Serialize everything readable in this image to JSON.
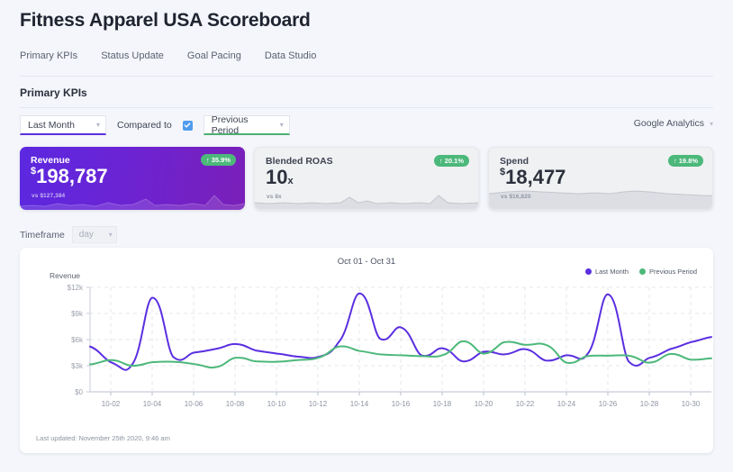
{
  "header": {
    "title": "Fitness Apparel USA Scoreboard",
    "tabs": [
      {
        "label": "Primary KPIs",
        "active": true
      },
      {
        "label": "Status Update",
        "active": false
      },
      {
        "label": "Goal Pacing",
        "active": false
      },
      {
        "label": "Data Studio",
        "active": false
      }
    ]
  },
  "section": {
    "title": "Primary KPIs"
  },
  "filters": {
    "date_range": "Last Month",
    "compare_label": "Compared to",
    "compare_checked": true,
    "compare_range": "Previous Period",
    "data_source": "Google Analytics",
    "chevron": "chevron-down-icon"
  },
  "cards": [
    {
      "label": "Revenue",
      "symbol": "$",
      "value": "198,787",
      "suffix": "",
      "prev": "vs $127,384",
      "delta": "35.9%",
      "delta_arrow": "↑",
      "delta_color": "#4cb87a",
      "style": "primary"
    },
    {
      "label": "Blended ROAS",
      "symbol": "",
      "value": "10",
      "suffix": "x",
      "prev": "vs 8x",
      "delta": "20.1%",
      "delta_arrow": "↑",
      "delta_color": "#4cb87a",
      "style": "muted"
    },
    {
      "label": "Spend",
      "symbol": "$",
      "value": "18,477",
      "suffix": "",
      "prev": "vs $16,820",
      "delta": "19.8%",
      "delta_arrow": "↑",
      "delta_color": "#4cb87a",
      "style": "muted"
    }
  ],
  "timeframe": {
    "label": "Timeframe",
    "value": "day"
  },
  "chart_panel": {
    "range_title": "Oct 01 - Oct 31",
    "legend": [
      {
        "name": "Last Month",
        "color": "#5a2fe0"
      },
      {
        "name": "Previous Period",
        "color": "#4cb87a"
      }
    ],
    "updated": "Last updated: November 25th 2020, 9:46 am"
  },
  "chart_data": {
    "type": "line",
    "title": "Oct 01 - Oct 31",
    "xlabel": "",
    "ylabel": "Revenue",
    "ylim": [
      0,
      12000
    ],
    "yticks": [
      0,
      3000,
      6000,
      9000,
      12000
    ],
    "ytick_labels": [
      "$0",
      "$3k",
      "$6k",
      "$9k",
      "$12k"
    ],
    "grid": true,
    "legend_position": "top-right",
    "x": [
      "10-01",
      "10-02",
      "10-03",
      "10-04",
      "10-05",
      "10-06",
      "10-07",
      "10-08",
      "10-09",
      "10-10",
      "10-11",
      "10-12",
      "10-13",
      "10-14",
      "10-15",
      "10-16",
      "10-17",
      "10-18",
      "10-19",
      "10-20",
      "10-21",
      "10-22",
      "10-23",
      "10-24",
      "10-25",
      "10-26",
      "10-27",
      "10-28",
      "10-29",
      "10-30",
      "10-31"
    ],
    "xtick_labels": [
      "10-02",
      "10-04",
      "10-06",
      "10-08",
      "10-10",
      "10-12",
      "10-14",
      "10-16",
      "10-18",
      "10-20",
      "10-22",
      "10-24",
      "10-26",
      "10-28",
      "10-30"
    ],
    "series": [
      {
        "name": "Last Month",
        "color": "#5a2fe0",
        "values": [
          5200,
          3400,
          3050,
          10800,
          4050,
          4500,
          4900,
          5500,
          4750,
          4400,
          4050,
          4000,
          5700,
          11300,
          6100,
          7400,
          4200,
          5000,
          3500,
          4600,
          4300,
          4900,
          3600,
          4200,
          4300,
          11200,
          3500,
          3900,
          4900,
          5700,
          6300
        ]
      },
      {
        "name": "Previous Period",
        "color": "#4cb87a",
        "values": [
          3150,
          3650,
          3000,
          3400,
          3450,
          3200,
          2800,
          3900,
          3500,
          3450,
          3650,
          3900,
          5200,
          4700,
          4300,
          4200,
          4100,
          4200,
          5800,
          4400,
          5700,
          5400,
          5400,
          3350,
          4100,
          4150,
          4150,
          3350,
          4350,
          3700,
          3850
        ]
      }
    ]
  }
}
